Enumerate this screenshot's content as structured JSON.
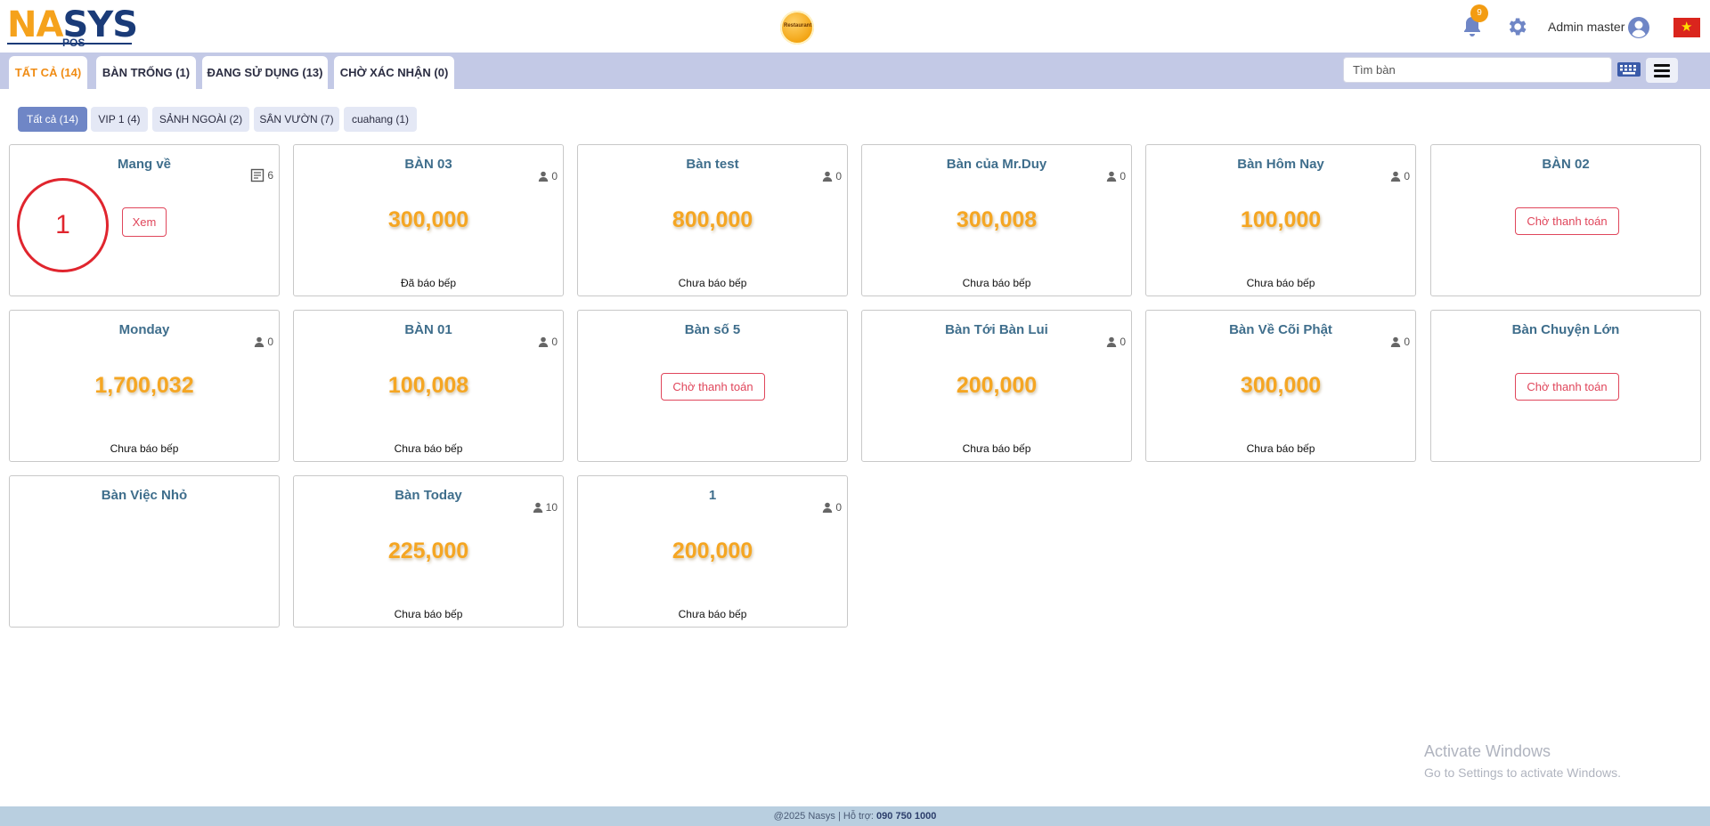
{
  "header": {
    "logo_text_na": "NA",
    "logo_text_s": "S",
    "logo_text_ys": "YS",
    "logo_sub": "POS",
    "emblem_text": "Restaurant",
    "notification_count": "9",
    "user_name": "Admin master",
    "flag_star": "★"
  },
  "tabs": [
    {
      "label": "TẤT CẢ (14)",
      "active": true
    },
    {
      "label": "BÀN TRỐNG (1)",
      "active": false
    },
    {
      "label": "ĐANG SỬ DỤNG (13)",
      "active": false
    },
    {
      "label": "CHỜ XÁC NHẬN (0)",
      "active": false
    }
  ],
  "search": {
    "placeholder": "Tìm bàn",
    "value": ""
  },
  "filters": [
    {
      "label": "Tất cả (14)",
      "active": true
    },
    {
      "label": "VIP 1 (4)",
      "active": false
    },
    {
      "label": "SẢNH NGOÀI (2)",
      "active": false
    },
    {
      "label": "SÂN VƯỜN (7)",
      "active": false
    },
    {
      "label": "cuahang (1)",
      "active": false
    }
  ],
  "takeaway": {
    "name": "Mang về",
    "order_count": "6",
    "circle_number": "1",
    "view_label": "Xem"
  },
  "tables": [
    {
      "name": "BÀN 03",
      "guests": "0",
      "amount": "300,000",
      "status": "Đã báo bếp"
    },
    {
      "name": "Bàn test",
      "guests": "0",
      "amount": "800,000",
      "status": "Chưa báo bếp"
    },
    {
      "name": "Bàn của Mr.Duy",
      "guests": "0",
      "amount": "300,008",
      "status": "Chưa báo bếp"
    },
    {
      "name": "Bàn Hôm Nay",
      "guests": "0",
      "amount": "100,000",
      "status": "Chưa báo bếp"
    },
    {
      "name": "BÀN 02",
      "pay_label": "Chờ thanh toán"
    },
    {
      "name": "Monday",
      "guests": "0",
      "amount": "1,700,032",
      "status": "Chưa báo bếp"
    },
    {
      "name": "BÀN 01",
      "guests": "0",
      "amount": "100,008",
      "status": "Chưa báo bếp"
    },
    {
      "name": "Bàn số 5",
      "pay_label": "Chờ thanh toán"
    },
    {
      "name": "Bàn Tới Bàn Lui",
      "guests": "0",
      "amount": "200,000",
      "status": "Chưa báo bếp"
    },
    {
      "name": "Bàn Về Cõi Phật",
      "guests": "0",
      "amount": "300,000",
      "status": "Chưa báo bếp"
    },
    {
      "name": "Bàn Chuyện Lớn",
      "pay_label": "Chờ thanh toán"
    },
    {
      "name": "Bàn Việc Nhỏ"
    },
    {
      "name": "Bàn Today",
      "guests": "10",
      "amount": "225,000",
      "status": "Chưa báo bếp"
    },
    {
      "name": "1",
      "guests": "0",
      "amount": "200,000",
      "status": "Chưa báo bếp"
    }
  ],
  "watermark": {
    "title": "Activate Windows",
    "subtitle": "Go to Settings to activate Windows."
  },
  "footer": {
    "text": "@2025 Nasys | Hỗ trợ: ",
    "phone": "090 750 1000"
  }
}
